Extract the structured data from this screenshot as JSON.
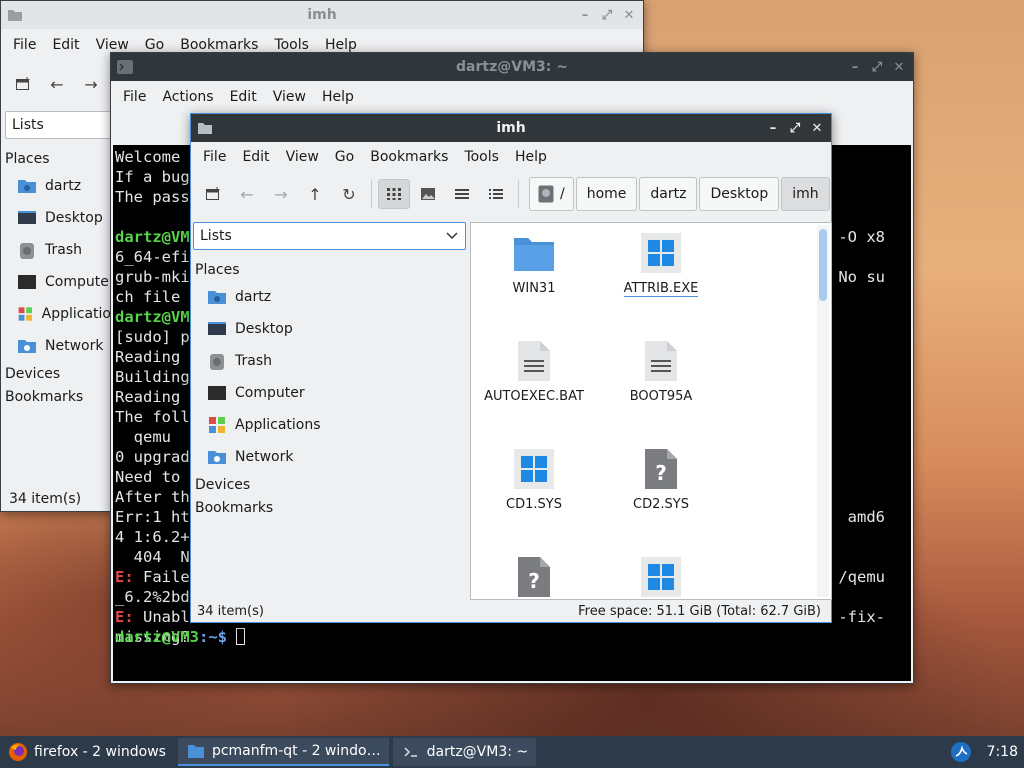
{
  "taskbar": {
    "items": [
      {
        "label": "firefox - 2 windows"
      },
      {
        "label": "pcmanfm-qt - 2 windo…"
      },
      {
        "label": "dartz@VM3: ~"
      }
    ],
    "clock": "7:18"
  },
  "back_window": {
    "title": "imh",
    "menu": [
      "File",
      "Edit",
      "View",
      "Go",
      "Bookmarks",
      "Tools",
      "Help"
    ],
    "side_select": "Lists",
    "places_label": "Places",
    "places": [
      "dartz",
      "Desktop",
      "Trash",
      "Compute",
      "Applicatio",
      "Network"
    ],
    "devices_label": "Devices",
    "bookmarks_label": "Bookmarks",
    "status": "34 item(s)"
  },
  "terminal": {
    "title": "dartz@VM3: ~",
    "menu": [
      "File",
      "Actions",
      "Edit",
      "View",
      "Help"
    ],
    "left_lines": [
      "Welcome",
      "If a bug",
      "The pass",
      "",
      "",
      "6_64-efi",
      "grub-mki",
      "ch file",
      "",
      "[sudo] p",
      "Reading",
      "Building",
      "Reading",
      "The foll",
      "  qemu",
      "0 upgrad",
      "Need to",
      "After th",
      "Err:1 ht",
      "4 1:6.2+",
      "  404  N",
      "",
      "_6.2%2bd",
      "",
      "missing?"
    ],
    "prompt_user": "dartz@VM3",
    "prompt_tail": ":~$ ",
    "error_prefix": "E:",
    "fail_word": "Faile",
    "unab_word": "Unabl",
    "right_lines": [
      {
        "top": 0,
        "text": "-O x8"
      },
      {
        "top": 0,
        "text": "No su"
      },
      {
        "top": 0,
        "text": "amd6"
      },
      {
        "top": 0,
        "text": "/qemu"
      },
      {
        "top": 0,
        "text": "-fix-"
      }
    ]
  },
  "front_window": {
    "title": "imh",
    "menu": [
      "File",
      "Edit",
      "View",
      "Go",
      "Bookmarks",
      "Tools",
      "Help"
    ],
    "breadcrumbs": [
      "/",
      "home",
      "dartz",
      "Desktop",
      "imh"
    ],
    "side_select": "Lists",
    "places_label": "Places",
    "places": [
      "dartz",
      "Desktop",
      "Trash",
      "Computer",
      "Applications",
      "Network"
    ],
    "devices_label": "Devices",
    "bookmarks_label": "Bookmarks",
    "status_left": "34 item(s)",
    "status_right": "Free space: 51.1 GiB (Total: 62.7 GiB)",
    "files": [
      {
        "name": "WIN31",
        "icon": "folder-icon"
      },
      {
        "name": "ATTRIB.EXE",
        "icon": "windows-exe-icon"
      },
      {
        "name": "AUTOEXEC.BAT",
        "icon": "text-file-icon"
      },
      {
        "name": "BOOT95A",
        "icon": "text-file-icon"
      },
      {
        "name": "CD1.SYS",
        "icon": "windows-exe-icon"
      },
      {
        "name": "CD2.SYS",
        "icon": "unknown-file-icon"
      },
      {
        "name": "",
        "icon": "unknown-file-icon"
      },
      {
        "name": "",
        "icon": "windows-exe-icon"
      }
    ]
  },
  "colors": {
    "titlebar_dark": "#31363b",
    "accent": "#4a90d9",
    "folder_blue": "#4a90d9",
    "win_blue": "#1e88e5",
    "taskbar": "#2d3a49"
  }
}
